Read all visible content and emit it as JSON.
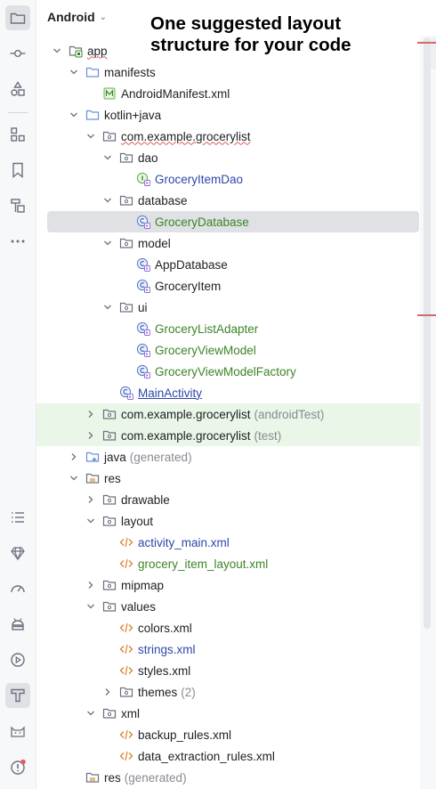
{
  "header": {
    "view_label": "Android",
    "annotation_line1": "One suggested layout",
    "annotation_line2": "structure for your code"
  },
  "toolstrip": {
    "top_icons": [
      "folder-icon",
      "commit-icon",
      "shapes-icon",
      "structure-icon",
      "bookmark-icon",
      "resource-manager-icon",
      "more-icon"
    ],
    "bottom_icons": [
      "list-icon",
      "gem-icon",
      "gauge-icon",
      "android-icon",
      "run-icon",
      "build-icon",
      "cat-icon",
      "problems-icon"
    ]
  },
  "tree": [
    {
      "label": "app",
      "depth": 0,
      "expanded": true,
      "icon": "module-icon",
      "style": "underline"
    },
    {
      "label": "manifests",
      "depth": 1,
      "expanded": true,
      "icon": "folder-icon"
    },
    {
      "label": "AndroidManifest.xml",
      "depth": 2,
      "leaf": true,
      "icon": "manifest-icon"
    },
    {
      "label": "kotlin+java",
      "depth": 1,
      "expanded": true,
      "icon": "folder-icon"
    },
    {
      "label": "com.example.grocerylist",
      "depth": 2,
      "expanded": true,
      "icon": "package-icon",
      "style": "underline"
    },
    {
      "label": "dao",
      "depth": 3,
      "expanded": true,
      "icon": "package-icon"
    },
    {
      "label": "GroceryItemDao",
      "depth": 4,
      "leaf": true,
      "icon": "interface-icon",
      "style": "blue"
    },
    {
      "label": "database",
      "depth": 3,
      "expanded": true,
      "icon": "package-icon"
    },
    {
      "label": "GroceryDatabase",
      "depth": 4,
      "leaf": true,
      "icon": "class-icon",
      "style": "green",
      "selected": true
    },
    {
      "label": "model",
      "depth": 3,
      "expanded": true,
      "icon": "package-icon"
    },
    {
      "label": "AppDatabase",
      "depth": 4,
      "leaf": true,
      "icon": "class-icon"
    },
    {
      "label": "GroceryItem",
      "depth": 4,
      "leaf": true,
      "icon": "class-icon"
    },
    {
      "label": "ui",
      "depth": 3,
      "expanded": true,
      "icon": "package-icon"
    },
    {
      "label": "GroceryListAdapter",
      "depth": 4,
      "leaf": true,
      "icon": "class-icon",
      "style": "green"
    },
    {
      "label": "GroceryViewModel",
      "depth": 4,
      "leaf": true,
      "icon": "class-icon",
      "style": "green"
    },
    {
      "label": "GroceryViewModelFactory",
      "depth": 4,
      "leaf": true,
      "icon": "class-icon",
      "style": "green"
    },
    {
      "label": "MainActivity",
      "depth": 3,
      "leaf": true,
      "icon": "class-icon",
      "style": "bluelink"
    },
    {
      "label": "com.example.grocerylist",
      "suffix": "(androidTest)",
      "depth": 2,
      "expanded": false,
      "icon": "package-icon",
      "bg": "green"
    },
    {
      "label": "com.example.grocerylist",
      "suffix": "(test)",
      "depth": 2,
      "expanded": false,
      "icon": "package-icon",
      "bg": "green"
    },
    {
      "label": "java",
      "suffix": "(generated)",
      "depth": 1,
      "expanded": false,
      "icon": "generated-folder-icon"
    },
    {
      "label": "res",
      "depth": 1,
      "expanded": true,
      "icon": "res-folder-icon"
    },
    {
      "label": "drawable",
      "depth": 2,
      "expanded": false,
      "icon": "package-icon"
    },
    {
      "label": "layout",
      "depth": 2,
      "expanded": true,
      "icon": "package-icon"
    },
    {
      "label": "activity_main.xml",
      "depth": 3,
      "leaf": true,
      "icon": "xml-icon",
      "style": "blue"
    },
    {
      "label": "grocery_item_layout.xml",
      "depth": 3,
      "leaf": true,
      "icon": "xml-icon",
      "style": "green"
    },
    {
      "label": "mipmap",
      "depth": 2,
      "expanded": false,
      "icon": "package-icon"
    },
    {
      "label": "values",
      "depth": 2,
      "expanded": true,
      "icon": "package-icon"
    },
    {
      "label": "colors.xml",
      "depth": 3,
      "leaf": true,
      "icon": "xml-icon"
    },
    {
      "label": "strings.xml",
      "depth": 3,
      "leaf": true,
      "icon": "xml-icon",
      "style": "blue"
    },
    {
      "label": "styles.xml",
      "depth": 3,
      "leaf": true,
      "icon": "xml-icon"
    },
    {
      "label": "themes",
      "suffix": "(2)",
      "depth": 3,
      "expanded": false,
      "icon": "package-icon"
    },
    {
      "label": "xml",
      "depth": 2,
      "expanded": true,
      "icon": "package-icon"
    },
    {
      "label": "backup_rules.xml",
      "depth": 3,
      "leaf": true,
      "icon": "xml-icon"
    },
    {
      "label": "data_extraction_rules.xml",
      "depth": 3,
      "leaf": true,
      "icon": "xml-icon"
    },
    {
      "label": "res",
      "suffix": "(generated)",
      "depth": 1,
      "leaf": true,
      "icon": "res-folder-icon"
    }
  ]
}
